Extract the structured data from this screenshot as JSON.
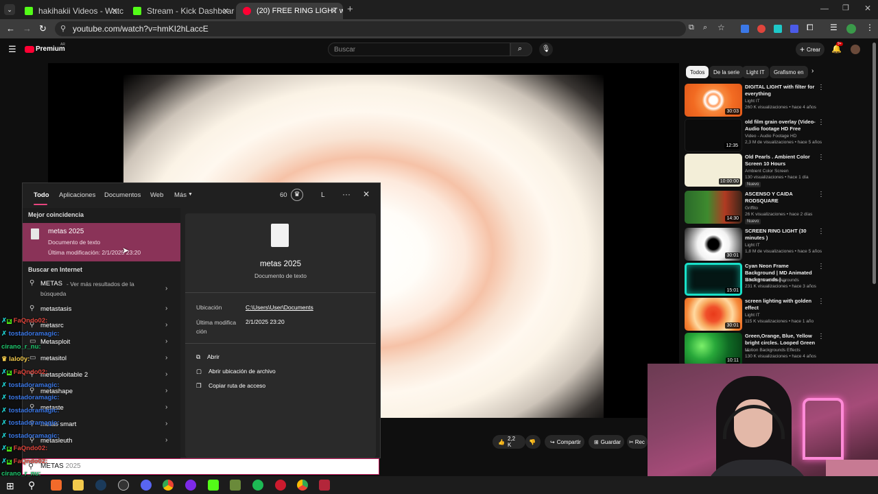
{
  "browser": {
    "tabs": [
      {
        "label": "hakihakii Videos - Watch On-De"
      },
      {
        "label": "Stream - Kick Dashboard"
      },
      {
        "label": "(20) FREE RING LIGHT with wa"
      }
    ],
    "url": "youtube.com/watch?v=hmKI2hLaccE",
    "new_tab": "+"
  },
  "youtube": {
    "logo": "Premium",
    "country": "AR",
    "search_placeholder": "Buscar",
    "create_label": "Crear",
    "notif_count": "9+",
    "chips": [
      "Todos",
      "De la serie",
      "Light IT",
      "Grafismo en"
    ],
    "actions": {
      "likes": "2,2 K",
      "share": "Compartir",
      "save": "Guardar",
      "clip": "Rec"
    },
    "recommended": [
      {
        "title": "DIGITAL LIGHT with filter for everything",
        "channel": "Light IT",
        "meta": "260 K visualizaciones • hace 4 años",
        "duration": "30:03",
        "new": ""
      },
      {
        "title": "old film grain overlay (Video-Audio footage HD Free",
        "channel": "Video - Audio Footage HD",
        "meta": "2,3 M de visualizaciones • hace 5 años",
        "duration": "12:35",
        "new": ""
      },
      {
        "title": "Old Pearls . Ambient Color Screen 10 Hours",
        "channel": "Ambient Color Screen",
        "meta": "130 visualizaciones • hace 1 día",
        "duration": "10:00:00",
        "new": "Nuevo"
      },
      {
        "title": "ASCENSO Y CAIDA RODSQUARE",
        "channel": "Griffito",
        "meta": "26 K visualizaciones • hace 2 días",
        "duration": "14:30",
        "new": "Nuevo"
      },
      {
        "title": "SCREEN RING LIGHT (30 minutes )",
        "channel": "Light IT",
        "meta": "1,8 M de visualizaciones • hace 5 años",
        "duration": "30:01",
        "new": ""
      },
      {
        "title": "Cyan Neon Frame Background | MD Animated Backgrounds | ...",
        "channel": "MD Animated Backgrounds",
        "meta": "231 K visualizaciones • hace 3 años",
        "duration": "15:01",
        "new": ""
      },
      {
        "title": "screen lighting with golden effect",
        "channel": "Light IT",
        "meta": "115 K visualizaciones • hace 1 año",
        "duration": "30:01",
        "new": ""
      },
      {
        "title": "Green,Orange, Blue, Yellow bright circles. Looped Green ...",
        "channel": "Motion Backgrounds Effects",
        "meta": "130 K visualizaciones • hace 4 años",
        "duration": "10:11",
        "new": ""
      }
    ]
  },
  "start_search": {
    "tabs": [
      "Todo",
      "Aplicaciones",
      "Documentos",
      "Web",
      "Más"
    ],
    "points": "60",
    "user_initial": "L",
    "best_match_header": "Mejor coincidencia",
    "best_match": {
      "name": "metas 2025",
      "type": "Documento de texto",
      "modified": "Última modificación: 2/1/2025 23:20"
    },
    "web_header": "Buscar en Internet",
    "web_first": {
      "term": "METAS",
      "rest": "- Ver más resultados de la",
      "rest2": "búsqueda"
    },
    "suggestions": [
      "metastasis",
      "metasrc",
      "Metasploit",
      "metasitol",
      "metasploitable 2",
      "metashape",
      "metaste",
      "metas smart",
      "metasleuth"
    ],
    "detail": {
      "name": "metas 2025",
      "type": "Documento de texto",
      "location_label": "Ubicación",
      "location": "C:\\Users\\User\\Documents",
      "modified_label": "Última modifica ción",
      "modified": "2/1/2025 23:20",
      "actions": [
        "Abrir",
        "Abrir ubicación de archivo",
        "Copiar ruta de acceso"
      ]
    },
    "query_typed": "METAS",
    "query_completion": " 2025"
  },
  "chat": [
    {
      "user": "FaQndo02:",
      "color": "#e0453c"
    },
    {
      "user": "tostadoramagic:",
      "color": "#3b78e7"
    },
    {
      "user": "cirano_r_nu:",
      "color": "#1ec86d"
    },
    {
      "user": "lalo0y:",
      "color": "#f2c94c"
    },
    {
      "user": "FaQndo02:",
      "color": "#e0453c"
    },
    {
      "user": "tostadoramagic:",
      "color": "#3b78e7"
    },
    {
      "user": "tostadoramagic:",
      "color": "#3b78e7"
    },
    {
      "user": "tostadoramagic:",
      "color": "#3b78e7"
    },
    {
      "user": "tostadoramagic:",
      "color": "#3b78e7"
    },
    {
      "user": "tostadoramagic:",
      "color": "#3b78e7"
    },
    {
      "user": "FaQndo02:",
      "color": "#e0453c"
    },
    {
      "user": "FaQndo02:",
      "color": "#e0453c"
    },
    {
      "user": "cirano_r_nu:",
      "color": "#1ec86d"
    }
  ]
}
